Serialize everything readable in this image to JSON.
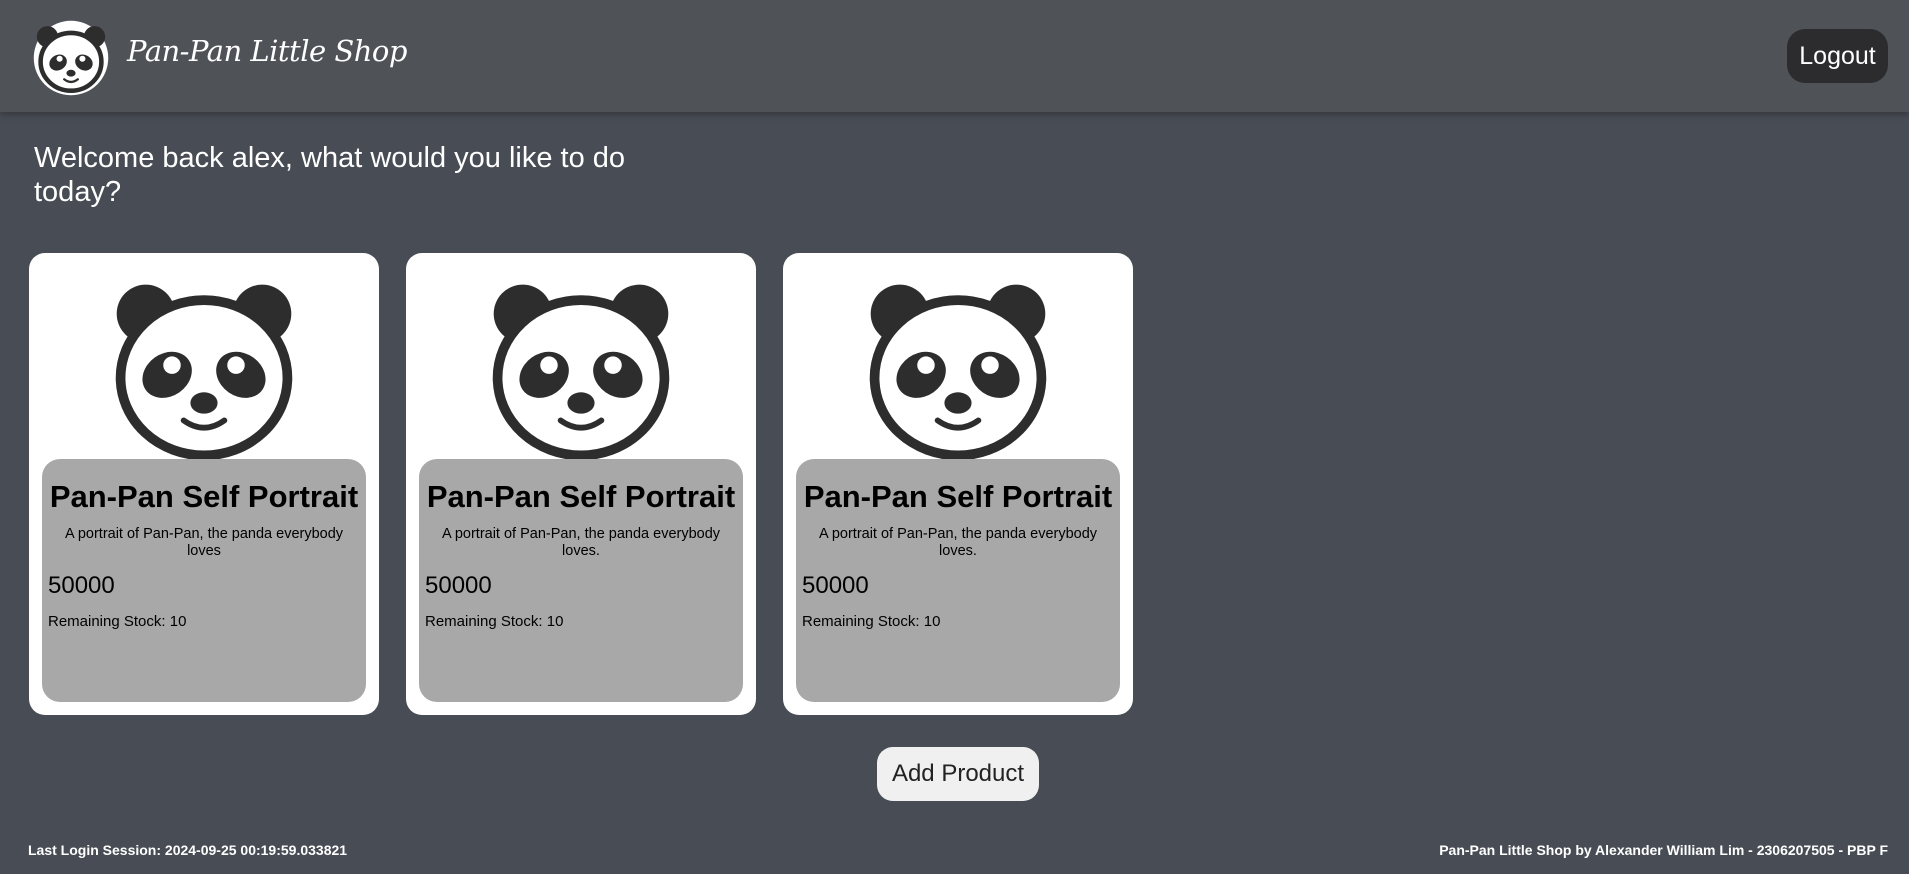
{
  "navbar": {
    "logo_icon": "panda-face-icon",
    "brand": "Pan-Pan Little Shop",
    "logout_label": "Logout"
  },
  "welcome": "Welcome back alex, what would you like to do today?",
  "products": [
    {
      "image_icon": "panda-face-icon",
      "name": "Pan-Pan Self Portrait",
      "description": "A portrait of Pan-Pan, the panda everybody loves",
      "price": "50000",
      "stock": "Remaining Stock: 10"
    },
    {
      "image_icon": "panda-face-icon",
      "name": "Pan-Pan Self Portrait",
      "description": "A portrait of Pan-Pan, the panda everybody loves.",
      "price": "50000",
      "stock": "Remaining Stock: 10"
    },
    {
      "image_icon": "panda-face-icon",
      "name": "Pan-Pan Self Portrait",
      "description": "A portrait of Pan-Pan, the panda everybody loves.",
      "price": "50000",
      "stock": "Remaining Stock: 10"
    }
  ],
  "add_product_label": "Add Product",
  "footer": {
    "last_login": "Last Login Session: 2024-09-25 00:19:59.033821",
    "credit": "Pan-Pan Little Shop by Alexander William Lim - 2306207505 - PBP F"
  },
  "colors": {
    "background": "#484c54",
    "navbar": "#4f5358",
    "card": "#ffffff",
    "card_body": "#a8a8a8",
    "logout_button": "#2c2c2e",
    "add_button": "#f0f0f0"
  }
}
